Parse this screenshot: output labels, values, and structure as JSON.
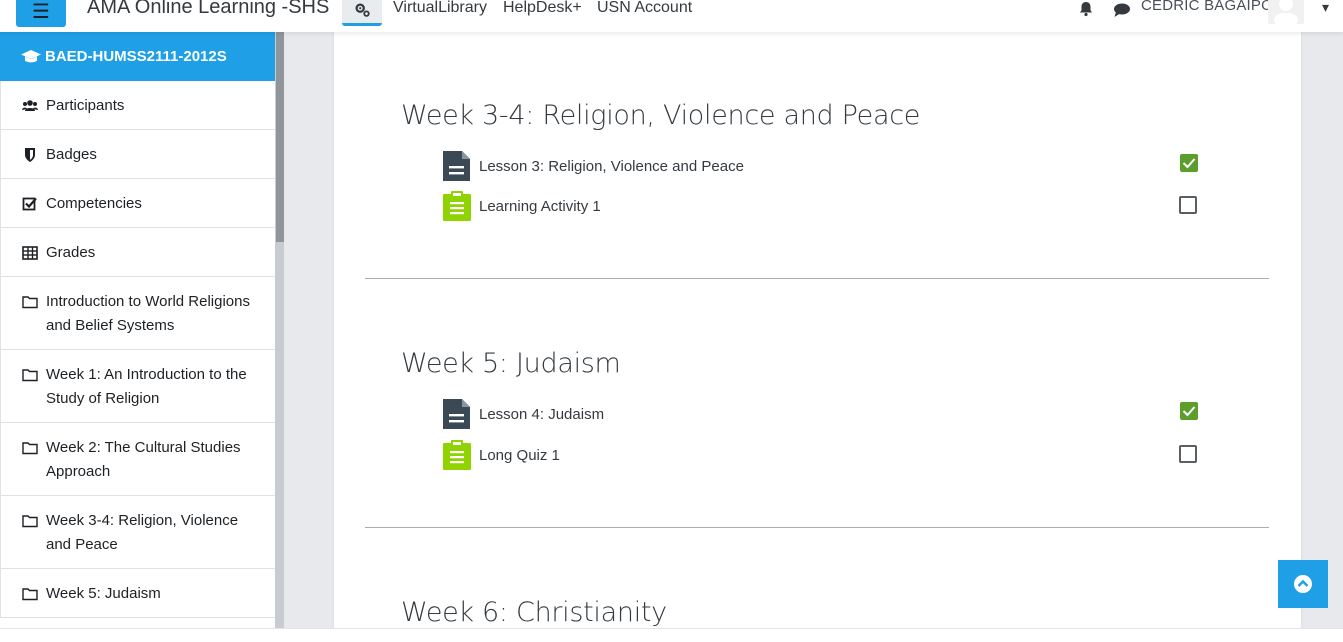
{
  "navbar": {
    "menu_icon": "hamburger-icon",
    "brand": "AMA Online Learning -SHS",
    "links": [
      "VirtualLibrary",
      "HelpDesk+",
      "USN Account"
    ],
    "user_name": "CEDRIC BAGAIPO"
  },
  "sidebar": {
    "course": "BAED-HUMSS2111-2012S",
    "items": [
      {
        "label": "Participants",
        "icon": "users-icon"
      },
      {
        "label": "Badges",
        "icon": "shield-icon"
      },
      {
        "label": "Competencies",
        "icon": "checkbox-icon"
      },
      {
        "label": "Grades",
        "icon": "table-icon"
      },
      {
        "label": "Introduction to World Religions and Belief Systems",
        "icon": "folder-icon"
      },
      {
        "label": "Week 1: An Introduction to the Study of Religion",
        "icon": "folder-icon"
      },
      {
        "label": "Week 2: The Cultural Studies Approach",
        "icon": "folder-icon"
      },
      {
        "label": "Week 3-4: Religion, Violence and Peace",
        "icon": "folder-icon"
      },
      {
        "label": "Week 5: Judaism",
        "icon": "folder-icon"
      }
    ]
  },
  "sections": [
    {
      "title": "Week 3-4: Religion, Violence and Peace",
      "activities": [
        {
          "name": "Lesson 3: Religion, Violence and Peace",
          "type": "file",
          "completed": true
        },
        {
          "name": "Learning Activity 1",
          "type": "assignment",
          "completed": false
        }
      ]
    },
    {
      "title": "Week 5: Judaism",
      "activities": [
        {
          "name": "Lesson 4: Judaism",
          "type": "file",
          "completed": true
        },
        {
          "name": "Long Quiz 1",
          "type": "assignment",
          "completed": false
        }
      ]
    },
    {
      "title": "Week 6: Christianity",
      "activities": []
    }
  ],
  "colors": {
    "accent": "#1f9fe6",
    "complete": "#5b9e2c",
    "assignment_icon": "#8fd400",
    "file_icon": "#3a4954"
  }
}
